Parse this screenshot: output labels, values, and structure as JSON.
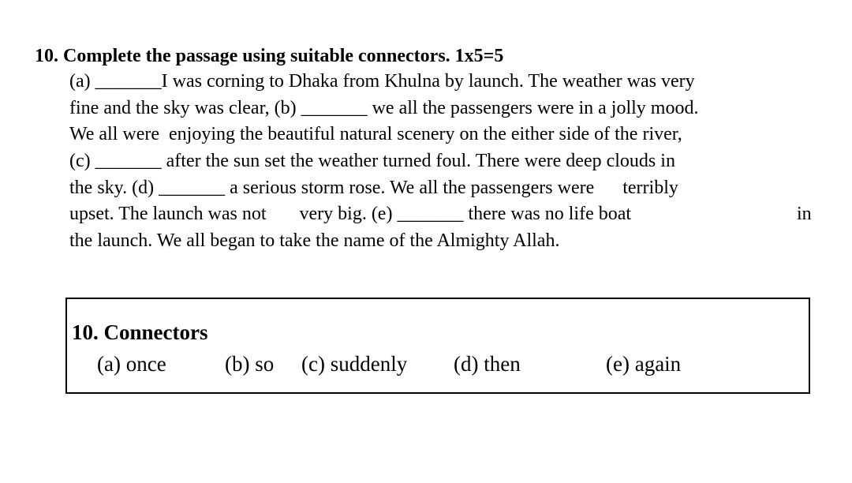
{
  "question": {
    "title": "10. Complete the passage using suitable connectors. 1x5=5",
    "lines": [
      "(a) _______I was corning to Dhaka from Khulna by launch. The weather was very",
      "fine and the sky was clear, (b) _______ we all the passengers were in a jolly mood.",
      "We all were  enjoying the beautiful natural scenery on the either side of the river,",
      "(c) _______ after the sun set the weather turned foul. There were deep clouds in",
      "the sky. (d) _______ a serious storm rose. We all the passengers were      terribly",
      "upset. The launch was not       very big. (e) _______ there was no life boat",
      "the launch. We all began to take the name of the Almighty Allah."
    ],
    "line6_trailing": "in"
  },
  "answers": {
    "title": "10. Connectors",
    "items": [
      {
        "label": "(a) once"
      },
      {
        "label": "(b) so"
      },
      {
        "label": "(c) suddenly"
      },
      {
        "label": "(d) then"
      },
      {
        "label": "(e) again"
      }
    ]
  }
}
